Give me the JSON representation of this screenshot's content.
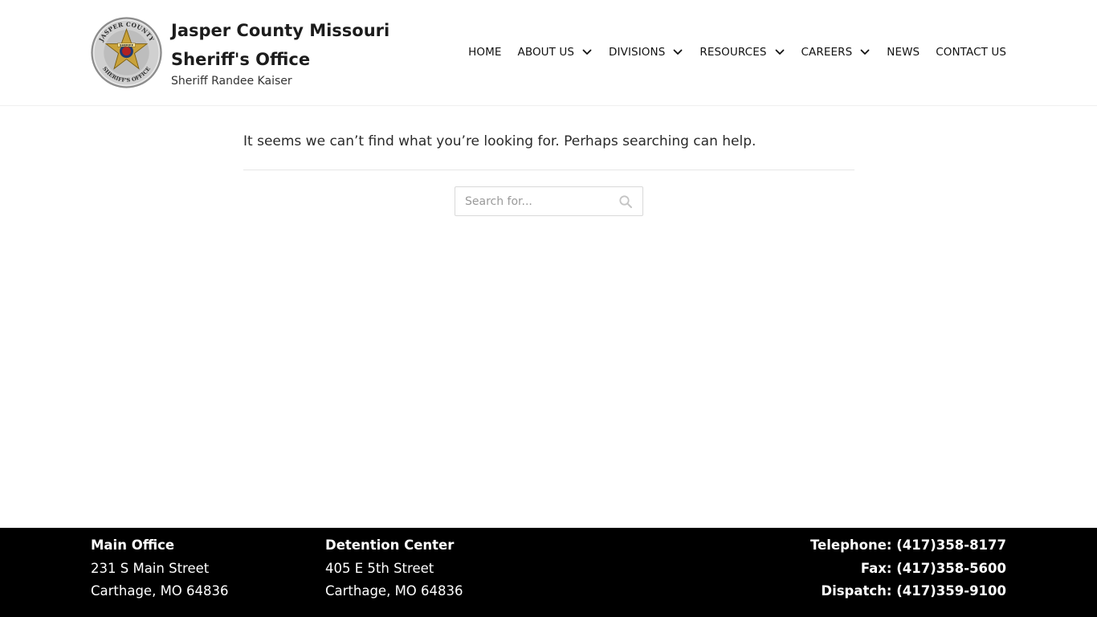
{
  "header": {
    "site_title": "Jasper County Missouri Sheriff's Office",
    "tagline": "Sheriff Randee Kaiser",
    "logo": {
      "icon": "sheriff-star-badge-icon",
      "ring_text_top": "JASPER COUNTY",
      "ring_text_bottom": "SHERIFF'S OFFICE",
      "star_text": "SHERIFF",
      "colors": {
        "star": "#c9a23a",
        "ring": "#9a9a9a",
        "center": "#1f3b73"
      }
    }
  },
  "nav": {
    "items": [
      {
        "label": "HOME",
        "has_dropdown": false
      },
      {
        "label": "ABOUT US",
        "has_dropdown": true
      },
      {
        "label": "DIVISIONS",
        "has_dropdown": true
      },
      {
        "label": "RESOURCES",
        "has_dropdown": true
      },
      {
        "label": "CAREERS",
        "has_dropdown": true
      },
      {
        "label": "NEWS",
        "has_dropdown": false
      },
      {
        "label": "CONTACT US",
        "has_dropdown": false
      }
    ],
    "dropdown_icon": "chevron-down-icon"
  },
  "main": {
    "message": "It seems we can’t find what you’re looking for. Perhaps searching can help.",
    "search": {
      "placeholder": "Search for...",
      "value": "",
      "icon": "search-icon"
    }
  },
  "footer": {
    "main_office": {
      "title": "Main Office",
      "street": "231 S Main Street",
      "city": "Carthage, MO 64836"
    },
    "detention_center": {
      "title": "Detention Center",
      "street": "405 E 5th Street",
      "city": "Carthage, MO 64836"
    },
    "contact": {
      "telephone": "Telephone: (417)358-8177",
      "fax": "Fax: (417)358-5600",
      "dispatch": "Dispatch: (417)359-9100"
    },
    "background": "#000000"
  }
}
